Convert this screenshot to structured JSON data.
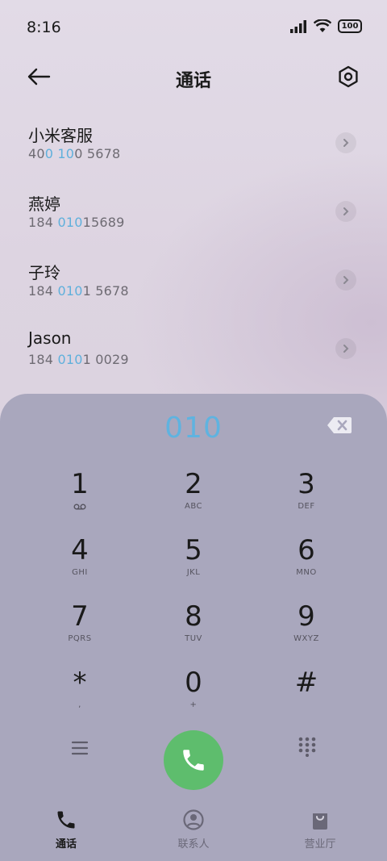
{
  "status_bar": {
    "time": "8:16",
    "battery": "100",
    "icons": [
      "signal-icon",
      "wifi-icon",
      "battery-icon"
    ]
  },
  "header": {
    "title": "通话",
    "back_icon": "arrow-left-icon",
    "settings_icon": "settings-hexagon-icon"
  },
  "contacts": [
    {
      "name": "小米客服",
      "number_parts": [
        "40",
        "0 10",
        "0 5678"
      ]
    },
    {
      "name": "燕婷",
      "number_parts": [
        "184 ",
        "010",
        "15689"
      ]
    },
    {
      "name": "子玲",
      "number_parts": [
        "184 ",
        "010",
        "1 5678"
      ]
    },
    {
      "name": "Jason",
      "number_parts": [
        "184 ",
        "010",
        "1 0029"
      ]
    }
  ],
  "dialer": {
    "input_value": "010",
    "keys": [
      {
        "digit": "1",
        "letters": ""
      },
      {
        "digit": "2",
        "letters": "ABC"
      },
      {
        "digit": "3",
        "letters": "DEF"
      },
      {
        "digit": "4",
        "letters": "GHI"
      },
      {
        "digit": "5",
        "letters": "JKL"
      },
      {
        "digit": "6",
        "letters": "MNO"
      },
      {
        "digit": "7",
        "letters": "PQRS"
      },
      {
        "digit": "8",
        "letters": "TUV"
      },
      {
        "digit": "9",
        "letters": "WXYZ"
      },
      {
        "digit": "*",
        "letters": ","
      },
      {
        "digit": "0",
        "letters": "+"
      },
      {
        "digit": "#",
        "letters": ""
      }
    ]
  },
  "bottom_nav": [
    {
      "label": "通话",
      "active": true
    },
    {
      "label": "联系人",
      "active": false
    },
    {
      "label": "营业厅",
      "active": false
    }
  ],
  "colors": {
    "highlight": "#5fb0dc",
    "call_button": "#5ebd6d",
    "dialer_panel": "#a9a7bd"
  }
}
